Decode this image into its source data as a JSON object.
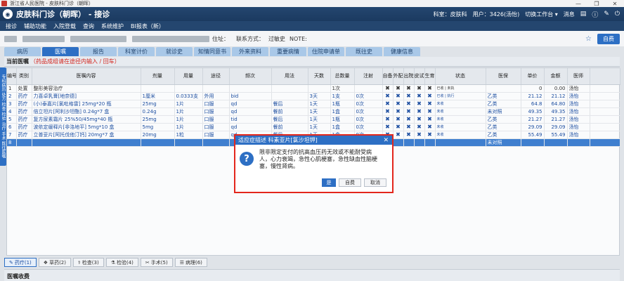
{
  "window": {
    "title": "浙江省人民医院 - 皮肤科门诊（朝晖）",
    "minimize": "—",
    "restore": "❐",
    "close": "✕"
  },
  "app": {
    "logo": "◉",
    "title": "皮肤科门诊（朝晖） - 接诊",
    "dept_label": "科室：皮肤科",
    "user_label": "用户：3426(汤怡)",
    "workbench": "切换工作台",
    "messages": "消息"
  },
  "menu": [
    "接诊",
    "辅助功能",
    "入院登载",
    "查询",
    "系统维护",
    "BI报表（新）"
  ],
  "info": {
    "address_label": "住址：",
    "contact_label": "联系方式：",
    "allergy_label": "过敏史",
    "note_label": "NOTE:",
    "selfpay": "自费"
  },
  "tabs": [
    "病历",
    "医嘱",
    "报告",
    "科室计价",
    "就诊史",
    "知情同意书",
    "外来资料",
    "重要病情",
    "住院申请单",
    "既往史",
    "健康信息"
  ],
  "active_tab": 1,
  "orders": {
    "title": "当前医嘱",
    "warning": "（药品成组请在途径内输入 / 回车）",
    "side_label": "专科病历 处方 检查 检验 治疗 手术 既往医嘱",
    "headers": [
      "编号",
      "类别",
      "医嘱内容",
      "剂量",
      "用量",
      "途径",
      "频次",
      "用法",
      "天数",
      "总数量",
      "注射",
      "自备",
      "外配",
      "出院",
      "皮试",
      "生育",
      "状态",
      "医保",
      "单价",
      "金额",
      "医师"
    ],
    "rows": [
      [
        "1",
        "处置",
        "整形美容治疗",
        "",
        "",
        "",
        "",
        "",
        "",
        "1次",
        "",
        "",
        "",
        "",
        "",
        "",
        "已收 | 未执",
        "",
        "0",
        "0.00",
        "汤怡"
      ],
      [
        "2",
        "药疗",
        "力喜卓乳膏[地奈德]",
        "1厘米",
        "0.0333支",
        "外用",
        "bid",
        "",
        "3天",
        "1支",
        "0次",
        "",
        "",
        "",
        "",
        "",
        "已收 | 执行",
        "乙类",
        "21.12",
        "21.12",
        "汤怡"
      ],
      [
        "3",
        "药疗",
        "(小)泰嘉片[氯吡格雷] 25mg*20 瓶",
        "25mg",
        "1片",
        "口服",
        "qd",
        "餐后",
        "1天",
        "1瓶",
        "0次",
        "",
        "",
        "",
        "",
        "",
        "未收",
        "乙类",
        "64.8",
        "64.80",
        "汤怡"
      ],
      [
        "4",
        "药疗",
        "倍立坦片[阿利沙坦酯] 0.24g*7 盒",
        "0.24g",
        "1片",
        "口服",
        "qd",
        "餐前",
        "1天",
        "1盒",
        "0次",
        "",
        "",
        "",
        "",
        "",
        "未收",
        "未对照",
        "49.35",
        "49.35",
        "汤怡"
      ],
      [
        "5",
        "药疗",
        "复方尿素霜片 25%50/45mg*40 瓶",
        "25mg",
        "1片",
        "口服",
        "tid",
        "餐后",
        "1天",
        "1瓶",
        "0次",
        "",
        "",
        "",
        "",
        "",
        "未收",
        "乙类",
        "21.27",
        "21.27",
        "汤怡"
      ],
      [
        "6",
        "药疗",
        "波依定缓释片[非洛地平] 5mg*10 盒",
        "5mg",
        "1片",
        "口服",
        "qd",
        "餐前",
        "1天",
        "1盒",
        "0次",
        "",
        "",
        "",
        "",
        "",
        "未收",
        "乙类",
        "29.09",
        "29.09",
        "汤怡"
      ],
      [
        "7",
        "药疗",
        "立普妥片[阿托伐他汀钙] 20mg*7 盒",
        "20mg",
        "1粒",
        "口服",
        "qd",
        "餐后",
        "1天",
        "1盒",
        "0次",
        "",
        "",
        "",
        "",
        "",
        "未收",
        "乙类",
        "55.49",
        "55.49",
        "汤怡"
      ],
      [
        "8",
        "",
        "",
        "",
        "",
        "",
        "",
        "",
        "",
        "",
        "",
        "",
        "",
        "",
        "",
        "",
        "",
        "未对照",
        "",
        "",
        ""
      ]
    ],
    "x_mark": "✖"
  },
  "bottom": [
    {
      "icon": "✎",
      "label": "药疗(1)"
    },
    {
      "icon": "❖",
      "label": "草药(2)"
    },
    {
      "icon": "⚕",
      "label": "检查(3)"
    },
    {
      "icon": "⚗",
      "label": "检验(4)"
    },
    {
      "icon": "✂",
      "label": "手术(5)"
    },
    {
      "icon": "☰",
      "label": "病理(6)"
    }
  ],
  "footer": "医嘱收费",
  "dialog": {
    "title": "适应症描述 科素亚片[氯沙坦钾]",
    "close": "✕",
    "icon": "?",
    "message": "限非限定支付的抗高血压药无效或不能耐受病人，心力衰竭，急性心肌梗塞，急性缺血性脑梗塞，慢性肾病。",
    "yes": "是",
    "selfpay": "自费",
    "cancel": "取消"
  }
}
